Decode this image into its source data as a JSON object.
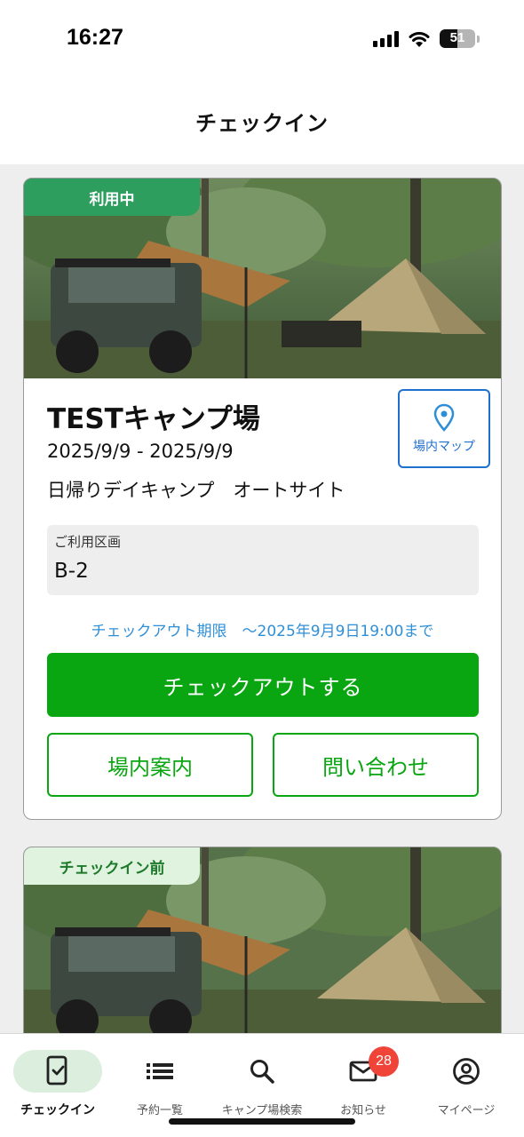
{
  "status_bar": {
    "time": "16:27",
    "battery": "51",
    "battery_level": 0.51
  },
  "header": {
    "title": "チェックイン"
  },
  "reservations": [
    {
      "status": "利用中",
      "name": "TESTキャンプ場",
      "dates": "2025/9/9 - 2025/9/9",
      "plan": "日帰りデイキャンプ　オートサイト",
      "map_button": "場内マップ",
      "section_label": "ご利用区画",
      "section_value": "B-2",
      "deadline": "チェックアウト期限　〜2025年9月9日19:00まで",
      "checkout_button": "チェックアウトする",
      "guide_button": "場内案内",
      "contact_button": "問い合わせ"
    },
    {
      "status": "チェックイン前"
    }
  ],
  "tab_bar": {
    "items": [
      {
        "label": "チェックイン",
        "icon": "phone-check-icon",
        "active": true
      },
      {
        "label": "予約一覧",
        "icon": "list-icon"
      },
      {
        "label": "キャンプ場検索",
        "icon": "search-icon"
      },
      {
        "label": "お知らせ",
        "icon": "mail-icon",
        "badge": "28"
      },
      {
        "label": "マイページ",
        "icon": "user-circle-icon"
      }
    ]
  },
  "colors": {
    "primary_green": "#0aa612",
    "active_tag": "#2e9e5e",
    "link_blue": "#2f8fd6",
    "map_blue": "#1f6fcf",
    "badge_red": "#f04438"
  }
}
